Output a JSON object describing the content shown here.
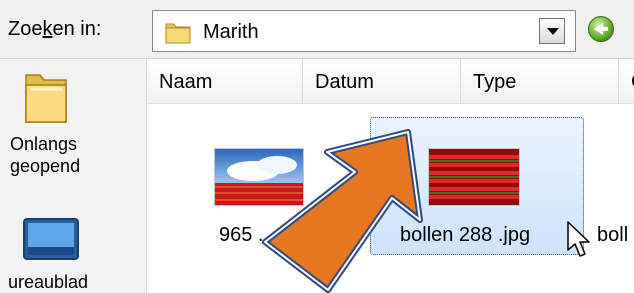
{
  "toolbar": {
    "lookin_label_pre": "Zoe",
    "lookin_label_ul": "k",
    "lookin_label_post": "en in:",
    "location": "Marith",
    "folder_icon": "folder-icon",
    "dropdown_icon": "chevron-down-icon",
    "back_icon": "back-arrow-icon"
  },
  "places": {
    "items": [
      {
        "label_line1": "Onlangs",
        "label_line2": "geopend",
        "icon": "folder-icon"
      },
      {
        "label_line1": "ureaublad",
        "label_line2": "",
        "icon": "desktop-icon"
      }
    ]
  },
  "columns": [
    "Naam",
    "Datum",
    "Type",
    "G"
  ],
  "files": [
    {
      "label": "965 ...",
      "icon": "image-thumbnail"
    },
    {
      "label": "bollen 288 .jpg",
      "icon": "image-thumbnail",
      "selected": true
    },
    {
      "label": "boll",
      "icon": "image-thumbnail"
    }
  ],
  "colors": {
    "selection": "#cfe3fb",
    "arrow": "#e87722",
    "arrow_outline": "#2e4a80"
  }
}
